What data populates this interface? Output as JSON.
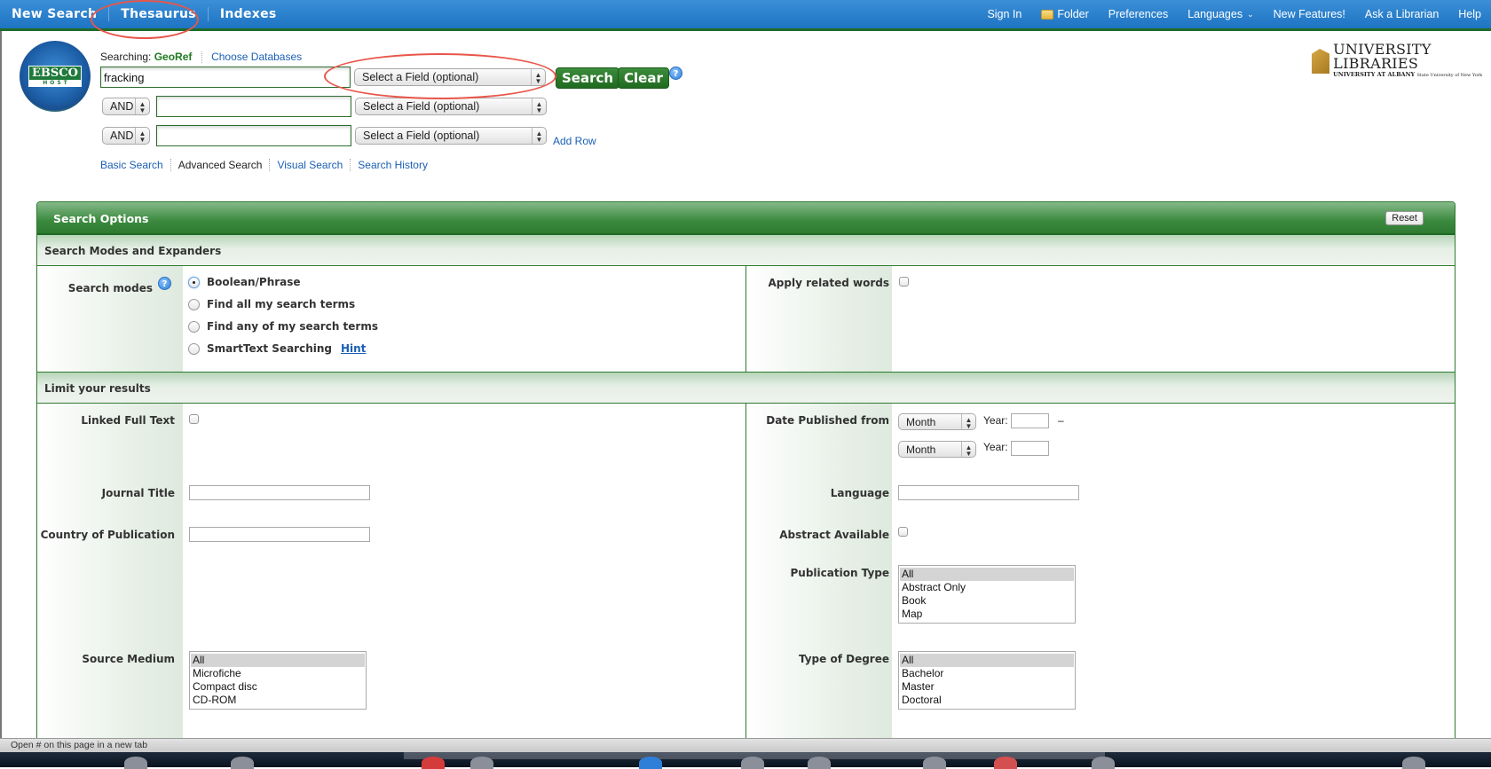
{
  "topnav": {
    "left": [
      "New Search",
      "Thesaurus",
      "Indexes"
    ],
    "right": {
      "sign_in": "Sign In",
      "folder": "Folder",
      "preferences": "Preferences",
      "languages": "Languages",
      "new_features": "New Features!",
      "ask_librarian": "Ask a Librarian",
      "help": "Help"
    }
  },
  "logo": {
    "line1": "EBSCO",
    "line2": "HOST"
  },
  "search": {
    "searching_label": "Searching:",
    "database": "GeoRef",
    "choose_databases": "Choose Databases",
    "rows": [
      {
        "operator": "",
        "value": "fracking",
        "field": "Select a Field (optional)"
      },
      {
        "operator": "AND",
        "value": "",
        "field": "Select a Field (optional)"
      },
      {
        "operator": "AND",
        "value": "",
        "field": "Select a Field (optional)"
      }
    ],
    "search_button": "Search",
    "clear_button": "Clear",
    "help_glyph": "?",
    "add_row": "Add Row",
    "modes": [
      "Basic Search",
      "Advanced Search",
      "Visual Search",
      "Search History"
    ],
    "current_mode": "Advanced Search"
  },
  "institution": {
    "title": "UNIVERSITY LIBRARIES",
    "subtitle": "UNIVERSITY AT ALBANY",
    "subtitle2": "State University of New York"
  },
  "options": {
    "title": "Search Options",
    "reset": "Reset",
    "modes_section": {
      "title": "Search Modes and Expanders",
      "search_modes_label": "Search modes",
      "radios": [
        {
          "label": "Boolean/Phrase",
          "checked": true
        },
        {
          "label": "Find all my search terms",
          "checked": false
        },
        {
          "label": "Find any of my search terms",
          "checked": false
        },
        {
          "label": "SmartText Searching",
          "checked": false
        }
      ],
      "hint": "Hint",
      "apply_related_words": "Apply related words",
      "apply_related_checked": false
    },
    "limits_section": {
      "title": "Limit your results",
      "linked_full_text": "Linked Full Text",
      "journal_title": "Journal Title",
      "country_of_publication": "Country of Publication",
      "source_medium": "Source Medium",
      "source_medium_options": [
        "All",
        "Microfiche",
        "Compact disc",
        "CD-ROM"
      ],
      "date_published_from": "Date Published from",
      "month_placeholder": "Month",
      "year_label": "Year:",
      "date_dash": "–",
      "language": "Language",
      "abstract_available": "Abstract Available",
      "publication_type": "Publication Type",
      "publication_type_options": [
        "All",
        "Abstract Only",
        "Book",
        "Map"
      ],
      "type_of_degree": "Type of Degree",
      "type_of_degree_options": [
        "All",
        "Bachelor",
        "Master",
        "Doctoral"
      ]
    }
  },
  "statusbar": {
    "text": "Open # on this page in a new tab"
  }
}
